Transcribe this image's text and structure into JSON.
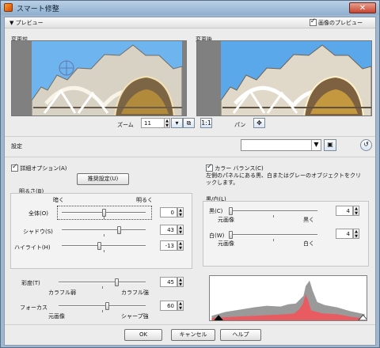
{
  "window": {
    "title": "スマート修整",
    "close": "✕"
  },
  "preview": {
    "section_label": "プレビュー",
    "toggle_symbol": "▼",
    "image_preview_label": "画像のプレビュー",
    "image_preview_checked": true,
    "before_label": "変更前",
    "after_label": "変更後",
    "zoom_label": "ズーム",
    "zoom_value": "11",
    "pan_label": "パン"
  },
  "settings": {
    "label": "設定",
    "preset_value": ""
  },
  "options": {
    "advanced_label": "詳細オプション(A)",
    "advanced_checked": true,
    "recommend_button": "推奨設定(U)",
    "color_balance_label": "カラー バランス(C)",
    "color_balance_checked": true,
    "color_balance_help": "左側のパネルにある黒、白またはグレーのオブジェクトをクリックします。"
  },
  "brightness": {
    "title": "明るさ(B)",
    "dark_label": "暗く",
    "bright_label": "明るく",
    "rows": [
      {
        "label": "全体(O)",
        "value": "0",
        "level": 0.5
      },
      {
        "label": "シャドウ(S)",
        "value": "43",
        "level": 0.68
      },
      {
        "label": "ハイライト(H)",
        "value": "-13",
        "level": 0.44
      }
    ]
  },
  "saturation": {
    "label": "彩度(T)",
    "value": "45",
    "weak_label": "カラフル弱",
    "strong_label": "カラフル強",
    "level": 0.66
  },
  "focus": {
    "label": "フォーカス",
    "value": "60",
    "original_label": "元画像",
    "sharp_label": "シャープ強",
    "level": 0.55
  },
  "black_white": {
    "title": "黒/白(L)",
    "black_label": "黒(C)",
    "black_value": "4",
    "black_original": "元画像",
    "black_more": "黒く",
    "black_level": 0.02,
    "white_label": "白(W)",
    "white_value": "4",
    "white_original": "元画像",
    "white_more": "白く",
    "white_level": 0.02
  },
  "buttons": {
    "ok": "OK",
    "cancel": "キャンセル",
    "help": "ヘルプ"
  }
}
